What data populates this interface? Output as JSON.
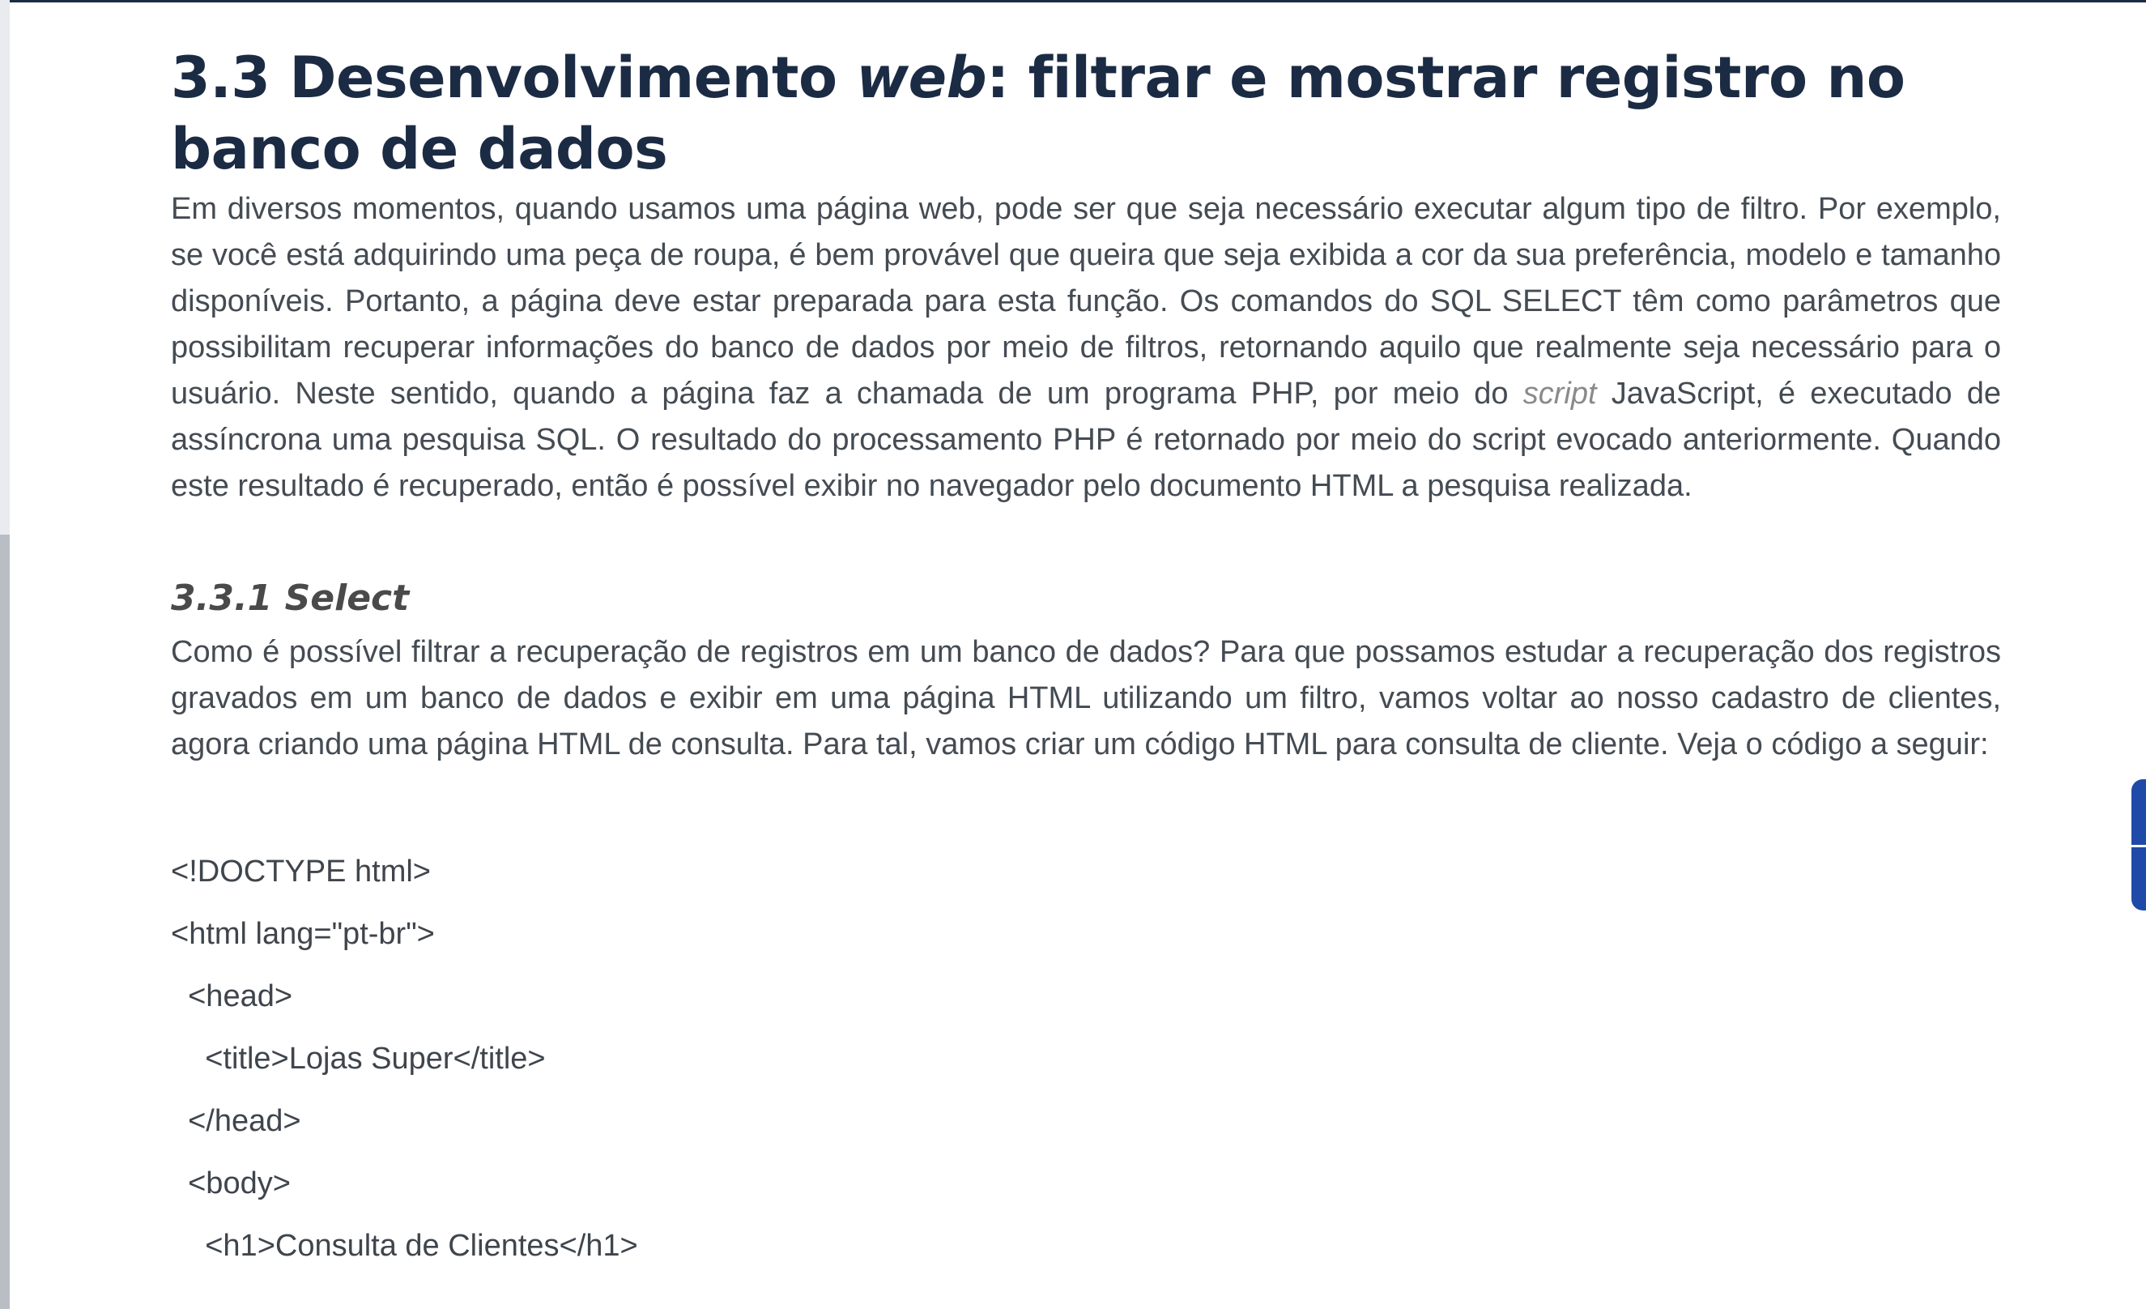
{
  "heading": {
    "prefix": "3.3 Desenvolvimento ",
    "italic": "web",
    "suffix": ": filtrar e mostrar registro no banco de dados"
  },
  "intro": {
    "part1": "Em diversos momentos, quando usamos uma página web, pode ser que seja necessário executar algum tipo de filtro. Por exemplo, se você está adquirindo uma peça de roupa, é bem provável que queira que seja exibida a cor da sua preferência, modelo e tamanho disponíveis. Portanto, a página deve estar preparada para esta função. Os comandos do SQL SELECT têm como parâmetros que possibilitam recuperar informações do banco de dados por meio de filtros, retornando aquilo que realmente seja necessário para o usuário. Neste sentido, quando a página faz a chamada de um programa PHP, por meio do ",
    "italic": "script",
    "part2": " JavaScript, é executado de assíncrona uma pesquisa SQL. O resultado do processamento PHP é retornado por meio do script evocado anteriormente. Quando este resultado é recuperado, então é possível exibir no navegador pelo documento HTML a pesquisa realizada."
  },
  "section": {
    "title": "3.3.1 Select",
    "text": "Como é possível filtrar a recuperação de registros em um banco de dados? Para que possamos estudar a recuperação dos registros gravados em um banco de dados e exibir em uma página HTML utilizando um filtro, vamos voltar ao nosso cadastro de clientes, agora criando uma página HTML de consulta. Para tal, vamos criar um código HTML para consulta de cliente. Veja o código a seguir:"
  },
  "code": [
    "<!DOCTYPE html>",
    "<html lang=\"pt-br\">",
    "  <head>",
    "    <title>Lojas Super</title>",
    "  </head>",
    "  <body>",
    "    <h1>Consulta de Clientes</h1>"
  ]
}
